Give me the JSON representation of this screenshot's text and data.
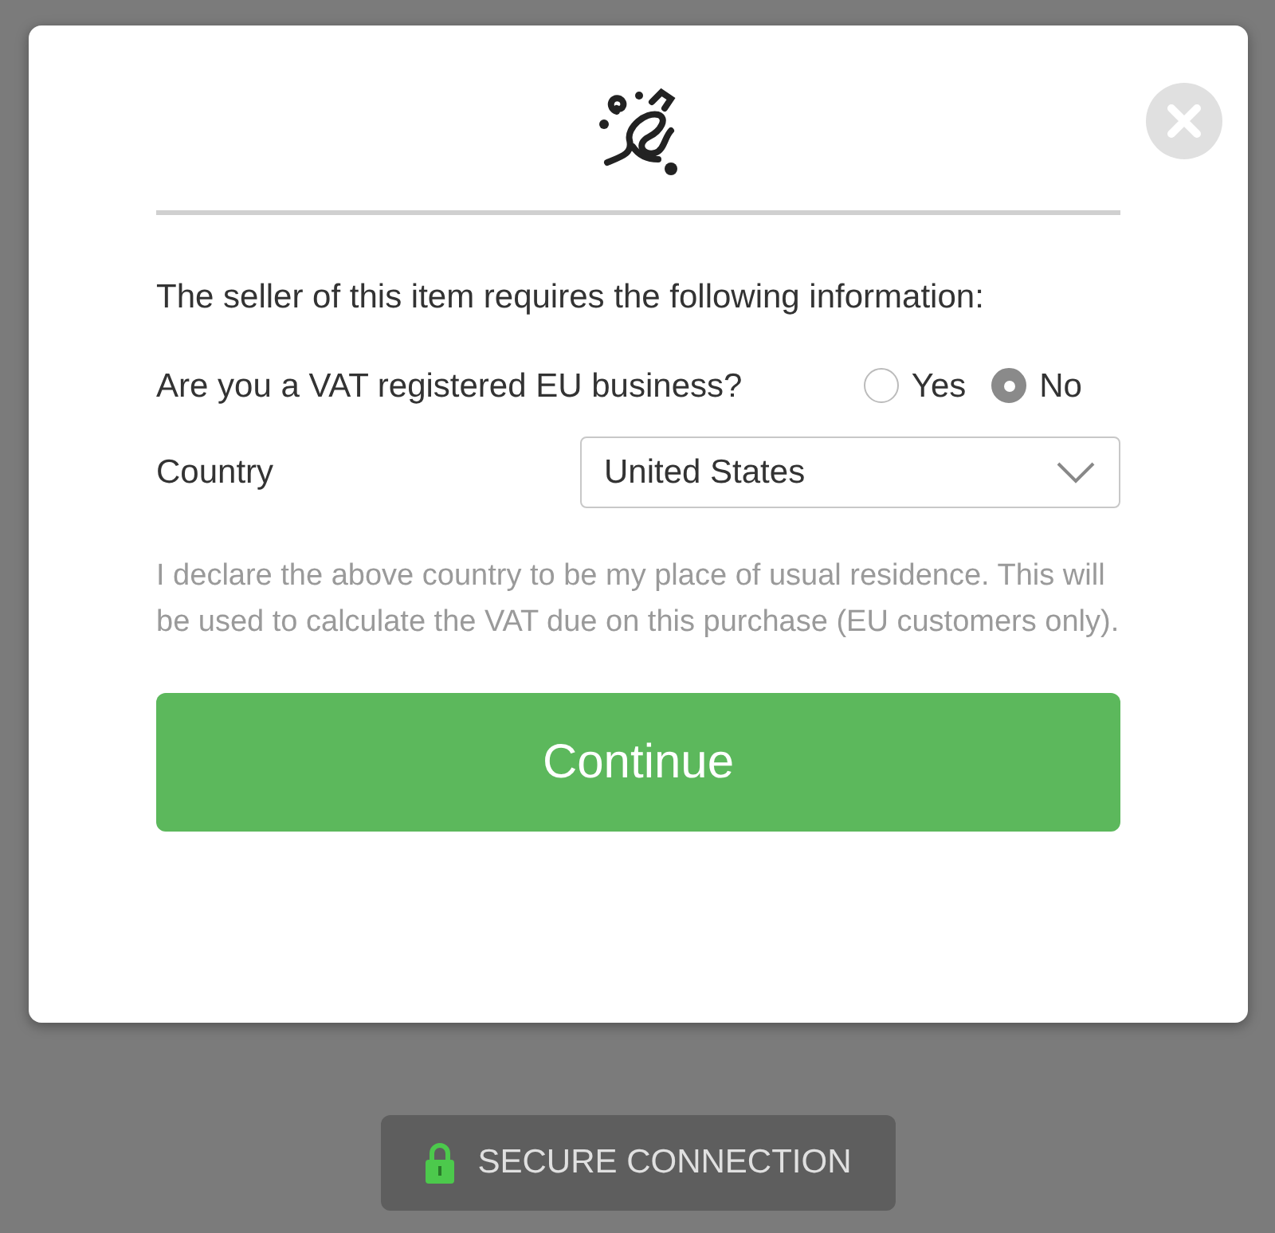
{
  "dialog": {
    "intro": "The seller of this item requires the following information:",
    "vat_question": {
      "label": "Are you a VAT registered EU business?",
      "options": [
        {
          "label": "Yes",
          "selected": false
        },
        {
          "label": "No",
          "selected": true
        }
      ]
    },
    "country": {
      "label": "Country",
      "value": "United States"
    },
    "declaration": "I declare the above country to be my place of usual residence. This will be used to calculate the VAT due on this purchase (EU customers only).",
    "continue_button": "Continue"
  },
  "secure_badge": "SECURE CONNECTION"
}
